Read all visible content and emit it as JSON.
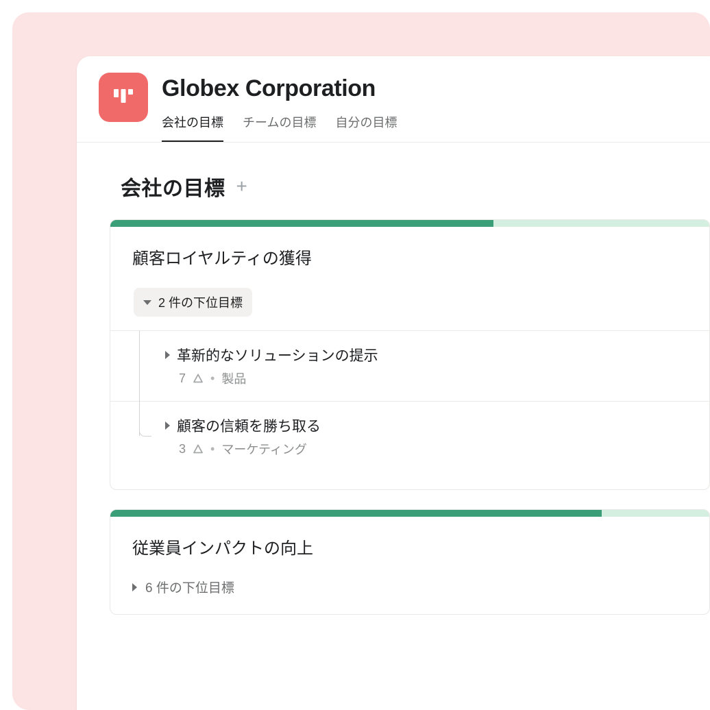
{
  "header": {
    "title": "Globex Corporation",
    "tabs": [
      {
        "label": "会社の目標",
        "active": true
      },
      {
        "label": "チームの目標",
        "active": false
      },
      {
        "label": "自分の目標",
        "active": false
      }
    ]
  },
  "section": {
    "title": "会社の目標"
  },
  "goals": [
    {
      "title": "顧客ロイヤルティの獲得",
      "progress_pct": 64,
      "subgoal_toggle": "2 件の下位目標",
      "expanded": true,
      "subgoals": [
        {
          "title": "革新的なソリューションの提示",
          "count": "7",
          "team": "製品"
        },
        {
          "title": "顧客の信頼を勝ち取る",
          "count": "3",
          "team": "マーケティング"
        }
      ]
    },
    {
      "title": "従業員インパクトの向上",
      "progress_pct": 82,
      "subgoal_toggle": "6 件の下位目標",
      "expanded": false,
      "subgoals": []
    }
  ]
}
